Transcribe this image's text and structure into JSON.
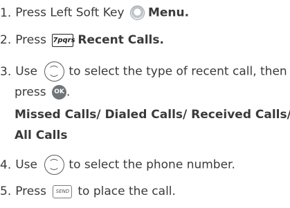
{
  "steps": [
    {
      "number": "1.",
      "text_before": "Press Left Soft Key",
      "icon": "left-soft-key-icon",
      "bold_text": "Menu."
    },
    {
      "number": "2.",
      "text_before": "Press",
      "icon": "key-7pqrs-icon",
      "icon_label": "7pqrs",
      "bold_text": "Recent Calls."
    },
    {
      "number": "3.",
      "text_before": "Use",
      "icon": "navigation-key-icon",
      "text_after": "to select the type of recent call, then",
      "line2_text": "press",
      "line2_icon": "ok-key-icon",
      "line2_icon_label": "OK",
      "line2_end": ".",
      "bold_line1": "Missed Calls/ Dialed Calls/ Received Calls/",
      "bold_line2": "All Calls"
    },
    {
      "number": "4.",
      "text_before": "Use",
      "icon": "navigation-key-icon",
      "text_after": "to select the phone number."
    },
    {
      "number": "5.",
      "text_before": "Press",
      "icon": "send-key-icon",
      "icon_label": "SEND",
      "text_after": "to place the call."
    }
  ]
}
